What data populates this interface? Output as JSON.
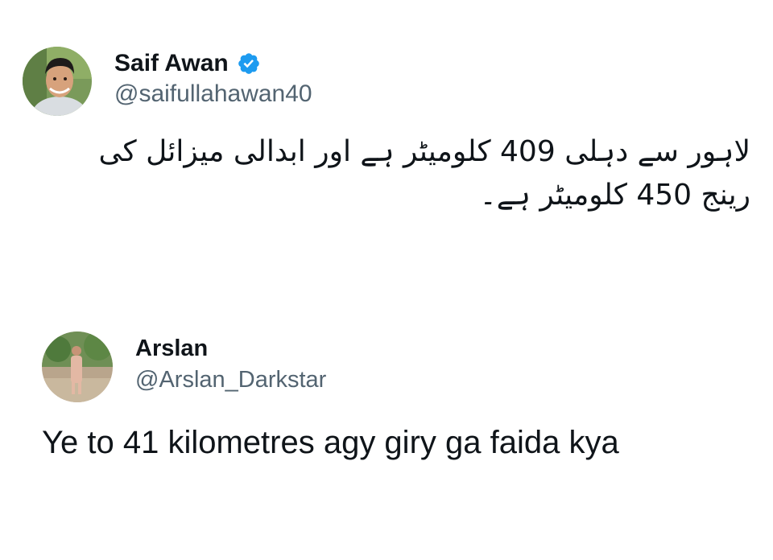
{
  "original_tweet": {
    "display_name": "Saif Awan",
    "handle": "@saifullahawan40",
    "verified_color": "#1d9bf0",
    "text": "لاہور سے دہلی 409 کلومیٹر ہے اور ابدالی میزائل کی رینج 450 کلومیٹر ہے۔"
  },
  "reply_tweet": {
    "display_name": "Arslan",
    "handle": "@Arslan_Darkstar",
    "text": "Ye to 41 kilometres agy giry ga faida kya"
  },
  "colors": {
    "text_primary": "#0f1419",
    "text_secondary": "#536471"
  }
}
